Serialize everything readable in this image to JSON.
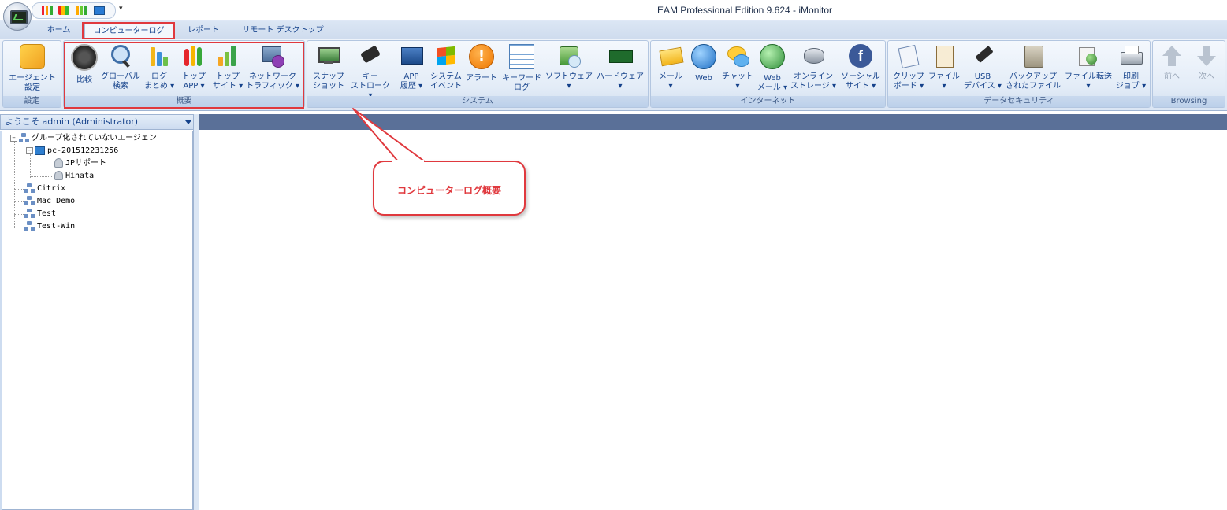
{
  "window": {
    "title": "EAM Professional Edition 9.624 - iMonitor"
  },
  "tabs": [
    {
      "label": "ホーム"
    },
    {
      "label": "コンピューターログ"
    },
    {
      "label": "レポート"
    },
    {
      "label": "リモート デスクトップ"
    }
  ],
  "ribbon": {
    "groups": [
      {
        "label": "設定",
        "buttons": [
          {
            "label": "エージェント\n設定",
            "icon": "agent-settings-icon"
          }
        ]
      },
      {
        "label": "概要",
        "buttons": [
          {
            "label": "比較",
            "icon": "compare-icon"
          },
          {
            "label": "グローバル\n検索",
            "icon": "search-icon"
          },
          {
            "label": "ログ\nまとめ ▾",
            "icon": "log-summary-icon"
          },
          {
            "label": "トップ\nAPP ▾",
            "icon": "top-app-icon"
          },
          {
            "label": "トップ\nサイト ▾",
            "icon": "top-site-icon"
          },
          {
            "label": "ネットワーク\nトラフィック ▾",
            "icon": "network-traffic-icon"
          }
        ]
      },
      {
        "label": "システム",
        "buttons": [
          {
            "label": "スナップ\nショット",
            "icon": "snapshot-icon"
          },
          {
            "label": "キー\nストローク ▾",
            "icon": "keystroke-icon"
          },
          {
            "label": "APP\n履歴 ▾",
            "icon": "app-history-icon"
          },
          {
            "label": "システム\nイベント",
            "icon": "system-event-icon"
          },
          {
            "label": "アラート",
            "icon": "alert-icon"
          },
          {
            "label": "キーワード\nログ",
            "icon": "keyword-log-icon"
          },
          {
            "label": "ソフトウェア\n▾",
            "icon": "software-icon"
          },
          {
            "label": "ハードウェア\n▾",
            "icon": "hardware-icon"
          }
        ]
      },
      {
        "label": "インターネット",
        "buttons": [
          {
            "label": "メール\n▾",
            "icon": "mail-icon"
          },
          {
            "label": "Web",
            "icon": "web-globe-icon"
          },
          {
            "label": "チャット\n▾",
            "icon": "chat-icon"
          },
          {
            "label": "Web\nメール ▾",
            "icon": "webmail-icon"
          },
          {
            "label": "オンライン\nストレージ ▾",
            "icon": "online-storage-icon"
          },
          {
            "label": "ソーシャル\nサイト ▾",
            "icon": "social-icon"
          }
        ]
      },
      {
        "label": "データセキュリティ",
        "buttons": [
          {
            "label": "クリップ\nボード ▾",
            "icon": "clipboard-icon"
          },
          {
            "label": "ファイル\n▾",
            "icon": "file-icon"
          },
          {
            "label": "USB\nデバイス ▾",
            "icon": "usb-icon"
          },
          {
            "label": "バックアップ\nされたファイル",
            "icon": "backup-icon"
          },
          {
            "label": "ファイル転送\n▾",
            "icon": "file-transfer-icon"
          },
          {
            "label": "印刷\nジョブ ▾",
            "icon": "print-icon"
          }
        ]
      },
      {
        "label": "Browsing",
        "buttons": [
          {
            "label": "前へ",
            "icon": "arrow-up-icon"
          },
          {
            "label": "次へ",
            "icon": "arrow-down-icon"
          }
        ]
      }
    ]
  },
  "left_panel": {
    "header": "ようこそ admin (Administrator)",
    "tree": [
      {
        "label": "グループ化されていないエージェン"
      },
      {
        "label": "pc-201512231256"
      },
      {
        "label": "JPサポート"
      },
      {
        "label": "Hinata"
      },
      {
        "label": "Citrix"
      },
      {
        "label": "Mac Demo"
      },
      {
        "label": "Test"
      },
      {
        "label": "Test-Win"
      }
    ]
  },
  "callout": {
    "text": "コンピューターログ概要"
  },
  "colors": {
    "highlight": "#e0393e",
    "content_bar": "#5a7098",
    "ribbon_text": "#15428b"
  }
}
